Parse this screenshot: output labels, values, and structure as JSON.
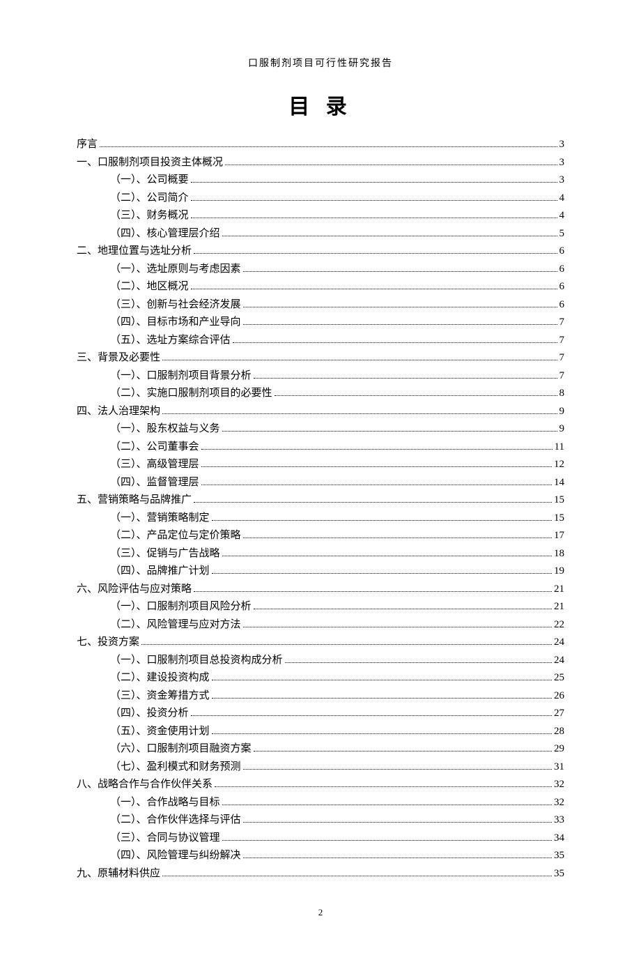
{
  "header_title": "口服制剂项目可行性研究报告",
  "main_title": "目 录",
  "page_number": "2",
  "entries": [
    {
      "level": 1,
      "label": "序言",
      "page": "3"
    },
    {
      "level": 1,
      "label": "一、口服制剂项目投资主体概况",
      "page": "3"
    },
    {
      "level": 2,
      "label": "（一）、公司概要",
      "page": "3"
    },
    {
      "level": 2,
      "label": "（二）、公司简介",
      "page": "4"
    },
    {
      "level": 2,
      "label": "（三）、财务概况",
      "page": "4"
    },
    {
      "level": 2,
      "label": "（四）、核心管理层介绍",
      "page": "5"
    },
    {
      "level": 1,
      "label": "二、地理位置与选址分析",
      "page": "6"
    },
    {
      "level": 2,
      "label": "（一）、选址原则与考虑因素",
      "page": "6"
    },
    {
      "level": 2,
      "label": "（二）、地区概况",
      "page": "6"
    },
    {
      "level": 2,
      "label": "（三）、创新与社会经济发展",
      "page": "6"
    },
    {
      "level": 2,
      "label": "（四）、目标市场和产业导向",
      "page": "7"
    },
    {
      "level": 2,
      "label": "（五）、选址方案综合评估",
      "page": "7"
    },
    {
      "level": 1,
      "label": "三、背景及必要性",
      "page": "7"
    },
    {
      "level": 2,
      "label": "（一）、口服制剂项目背景分析",
      "page": "7"
    },
    {
      "level": 2,
      "label": "（二）、实施口服制剂项目的必要性",
      "page": "8"
    },
    {
      "level": 1,
      "label": "四、法人治理架构",
      "page": "9"
    },
    {
      "level": 2,
      "label": "（一）、股东权益与义务",
      "page": "9"
    },
    {
      "level": 2,
      "label": "（二）、公司董事会",
      "page": "11"
    },
    {
      "level": 2,
      "label": "（三）、高级管理层",
      "page": "12"
    },
    {
      "level": 2,
      "label": "（四）、监督管理层",
      "page": "14"
    },
    {
      "level": 1,
      "label": "五、营销策略与品牌推广",
      "page": "15"
    },
    {
      "level": 2,
      "label": "（一）、营销策略制定",
      "page": "15"
    },
    {
      "level": 2,
      "label": "（二）、产品定位与定价策略",
      "page": "17"
    },
    {
      "level": 2,
      "label": "（三）、促销与广告战略",
      "page": "18"
    },
    {
      "level": 2,
      "label": "（四）、品牌推广计划",
      "page": "19"
    },
    {
      "level": 1,
      "label": "六、风险评估与应对策略",
      "page": "21"
    },
    {
      "level": 2,
      "label": "（一）、口服制剂项目风险分析",
      "page": "21"
    },
    {
      "level": 2,
      "label": "（二）、风险管理与应对方法",
      "page": "22"
    },
    {
      "level": 1,
      "label": "七、投资方案",
      "page": "24"
    },
    {
      "level": 2,
      "label": "（一）、口服制剂项目总投资构成分析",
      "page": "24"
    },
    {
      "level": 2,
      "label": "（二）、建设投资构成",
      "page": "25"
    },
    {
      "level": 2,
      "label": "（三）、资金筹措方式",
      "page": "26"
    },
    {
      "level": 2,
      "label": "（四）、投资分析",
      "page": "27"
    },
    {
      "level": 2,
      "label": "（五）、资金使用计划",
      "page": "28"
    },
    {
      "level": 2,
      "label": "（六）、口服制剂项目融资方案",
      "page": "29"
    },
    {
      "level": 2,
      "label": "（七）、盈利模式和财务预测",
      "page": "31"
    },
    {
      "level": 1,
      "label": "八、战略合作与合作伙伴关系",
      "page": "32"
    },
    {
      "level": 2,
      "label": "（一）、合作战略与目标",
      "page": "32"
    },
    {
      "level": 2,
      "label": "（二）、合作伙伴选择与评估",
      "page": "33"
    },
    {
      "level": 2,
      "label": "（三）、合同与协议管理",
      "page": "34"
    },
    {
      "level": 2,
      "label": "（四）、风险管理与纠纷解决",
      "page": "35"
    },
    {
      "level": 1,
      "label": "九、原辅材料供应",
      "page": "35"
    }
  ]
}
